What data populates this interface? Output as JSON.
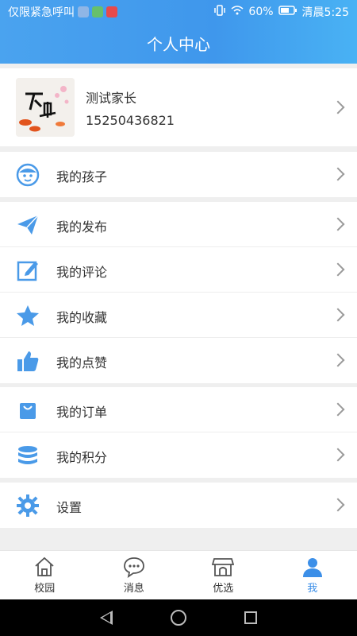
{
  "status": {
    "left_text": "仅限紧急呼叫",
    "right_text": "60%",
    "time": "清晨5:25"
  },
  "header": {
    "title": "个人中心"
  },
  "profile": {
    "name": "测试家长",
    "phone": "15250436821"
  },
  "menu": {
    "children": "我的孩子",
    "publish": "我的发布",
    "comments": "我的评论",
    "favorites": "我的收藏",
    "likes": "我的点赞",
    "orders": "我的订单",
    "points": "我的积分",
    "settings": "设置"
  },
  "tabs": [
    {
      "label": "校园",
      "icon": "home-icon"
    },
    {
      "label": "消息",
      "icon": "chat-icon"
    },
    {
      "label": "优选",
      "icon": "shop-icon"
    },
    {
      "label": "我",
      "icon": "user-icon",
      "active": true
    }
  ],
  "colors": {
    "accent": "#3c8fe8",
    "icon": "#4a9ae8"
  }
}
